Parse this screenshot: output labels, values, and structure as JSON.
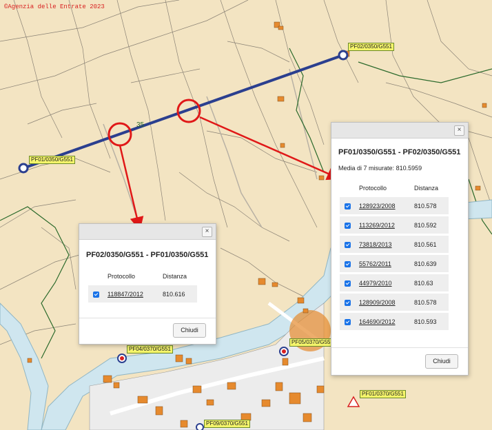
{
  "copyright": "©Agenzia delle Entrate 2023",
  "map": {
    "distance_label": "35",
    "point_labels": {
      "pf02_0350": "PF02/0350/G551",
      "pf01_0350": "PF01/0350/G551",
      "pf04_0370": "PF04/0370/G551",
      "pf05_0370": "PF05/0370/G55",
      "pf01_0370": "PF01/0370/G551",
      "pf09_0370": "PF09/0370/G551"
    },
    "colors": {
      "background": "#f3e4c2",
      "measure_line": "#2b3f8f",
      "highlight": "#e01818",
      "river": "#cfe6ef",
      "building": "#e68a2e"
    }
  },
  "dialog_left": {
    "title": "PF02/0350/G551 - PF01/0350/G551",
    "col_protocol": "Protocollo",
    "col_distance": "Distanza",
    "rows": [
      {
        "protocol": "118847/2012",
        "distance": "810.616",
        "checked": true
      }
    ],
    "close_label": "Chiudi",
    "close_icon": "×"
  },
  "dialog_right": {
    "title": "PF01/0350/G551 - PF02/0350/G551",
    "media_label": "Media di 7 misurate:",
    "media_value": "810.5959",
    "col_protocol": "Protocollo",
    "col_distance": "Distanza",
    "rows": [
      {
        "protocol": "128923/2008",
        "distance": "810.578",
        "checked": true
      },
      {
        "protocol": "113269/2012",
        "distance": "810.592",
        "checked": true
      },
      {
        "protocol": "73818/2013",
        "distance": "810.561",
        "checked": true
      },
      {
        "protocol": "55762/2011",
        "distance": "810.639",
        "checked": true
      },
      {
        "protocol": "44979/2010",
        "distance": "810.63",
        "checked": true
      },
      {
        "protocol": "128909/2008",
        "distance": "810.578",
        "checked": true
      },
      {
        "protocol": "164690/2012",
        "distance": "810.593",
        "checked": true
      }
    ],
    "close_label": "Chiudi",
    "close_icon": "×"
  }
}
